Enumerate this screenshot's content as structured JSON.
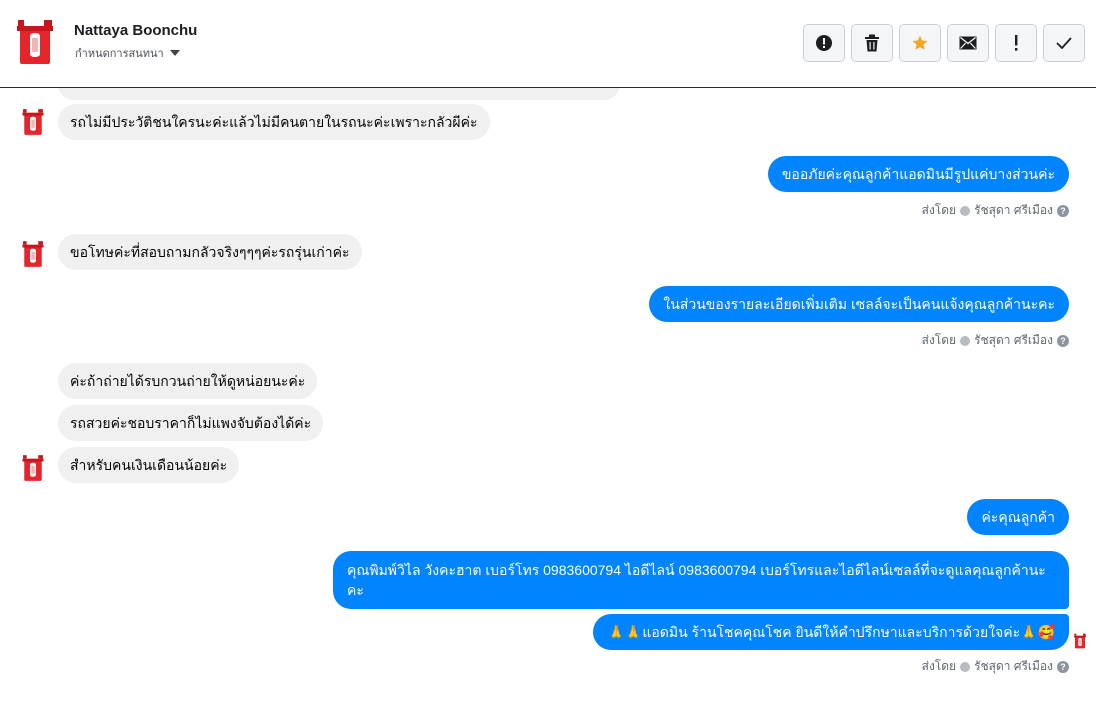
{
  "header": {
    "contact_name": "Nattaya Boonchu",
    "conversation_setting": "กำหนดการสนทนา"
  },
  "toolbar": {
    "buttons": [
      {
        "name": "report",
        "icon": "alert-circle-icon"
      },
      {
        "name": "delete",
        "icon": "trash-icon"
      },
      {
        "name": "star",
        "icon": "star-icon"
      },
      {
        "name": "mark-unread",
        "icon": "envelope-icon"
      },
      {
        "name": "mark-important",
        "icon": "exclamation-icon"
      },
      {
        "name": "mark-done",
        "icon": "check-icon"
      }
    ],
    "star_color": "#f5a623"
  },
  "messages": [
    {
      "side": "in",
      "text": "รถไม่มีประวัติชนใครนะค่ะแล้วไม่มีคนตายในรถนะค่ะเพราะกลัวผีค่ะ",
      "avatar": true
    },
    {
      "side": "out",
      "text": "ขออภัยค่ะคุณลูกค้าแอดมินมีรูปแค่บางส่วนค่ะ"
    },
    {
      "side": "in",
      "text": "ขอโทษค่ะที่สอบถามกลัวจริงๆๆๆค่ะรถรุ่นเก่าค่ะ",
      "avatar": true
    },
    {
      "side": "out",
      "text": "ในส่วนของรายละเอียดเพิ่มเติม  เซลล์จะเป็นคนแจ้งคุณลูกค้านะคะ"
    },
    {
      "side": "in",
      "text": "ค่ะถ้าถ่ายได้รบกวนถ่ายให้ดูหน่อยนะค่ะ"
    },
    {
      "side": "in",
      "text": "รถสวยค่ะชอบราคาก็ไม่แพงจับต้องได้ค่ะ"
    },
    {
      "side": "in",
      "text": "สำหรับคนเงินเดือนน้อยค่ะ",
      "avatar": true
    },
    {
      "side": "out",
      "text": "ค่ะคุณลูกค้า"
    },
    {
      "side": "out",
      "text": "คุณพิมพ์วิไล วังคะฮาต   เบอร์โทร 0983600794  ไอดีไลน์ 0983600794   เบอร์โทรและไอดีไลน์เซลล์ที่จะดูแลคุณลูกค้านะคะ"
    },
    {
      "side": "out",
      "text": "🙏🙏แอดมิน ร้านโชคคุณโชค ยินดีให้คำปรึกษาและบริการด้วยใจค่ะ🙏🥰"
    }
  ],
  "sent_by": {
    "label": "ส่งโดย",
    "agent": "รัชสุดา ศรีเมือง",
    "help": "?"
  },
  "colors": {
    "outgoing_bubble": "#0084ff",
    "incoming_bubble": "#f0f0f0",
    "brand_red": "#e4262c"
  }
}
